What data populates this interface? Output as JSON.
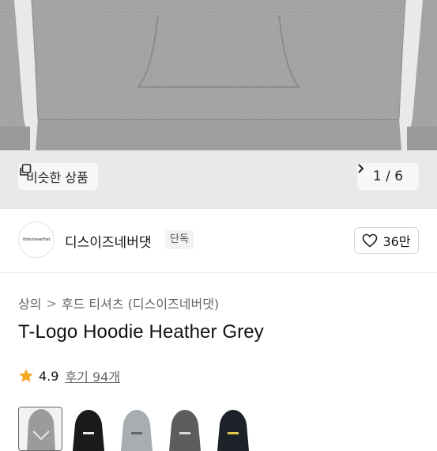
{
  "gallery": {
    "similar_label": "비슷한 상품",
    "counter": "1 / 6",
    "similar_icon": "copy-icon",
    "next_icon": "chevron-right-icon"
  },
  "brand": {
    "logo_text": "thisisneverthat",
    "name": "디스이즈네버댓",
    "badge": "단독",
    "like_count": "36만",
    "like_icon": "heart-icon"
  },
  "breadcrumb": {
    "level1": "상의",
    "sep": ">",
    "level2": "후드 티셔츠 (디스이즈네버댓)"
  },
  "product": {
    "title": "T-Logo Hoodie Heather Grey",
    "rating": "4.9",
    "reviews": "후기 94개",
    "star_color": "#f5a623"
  },
  "variants": {
    "colors": [
      "#9b9b9b",
      "#1b1b1b",
      "#a7adb0",
      "#5d5d60",
      "#1d2128"
    ]
  }
}
